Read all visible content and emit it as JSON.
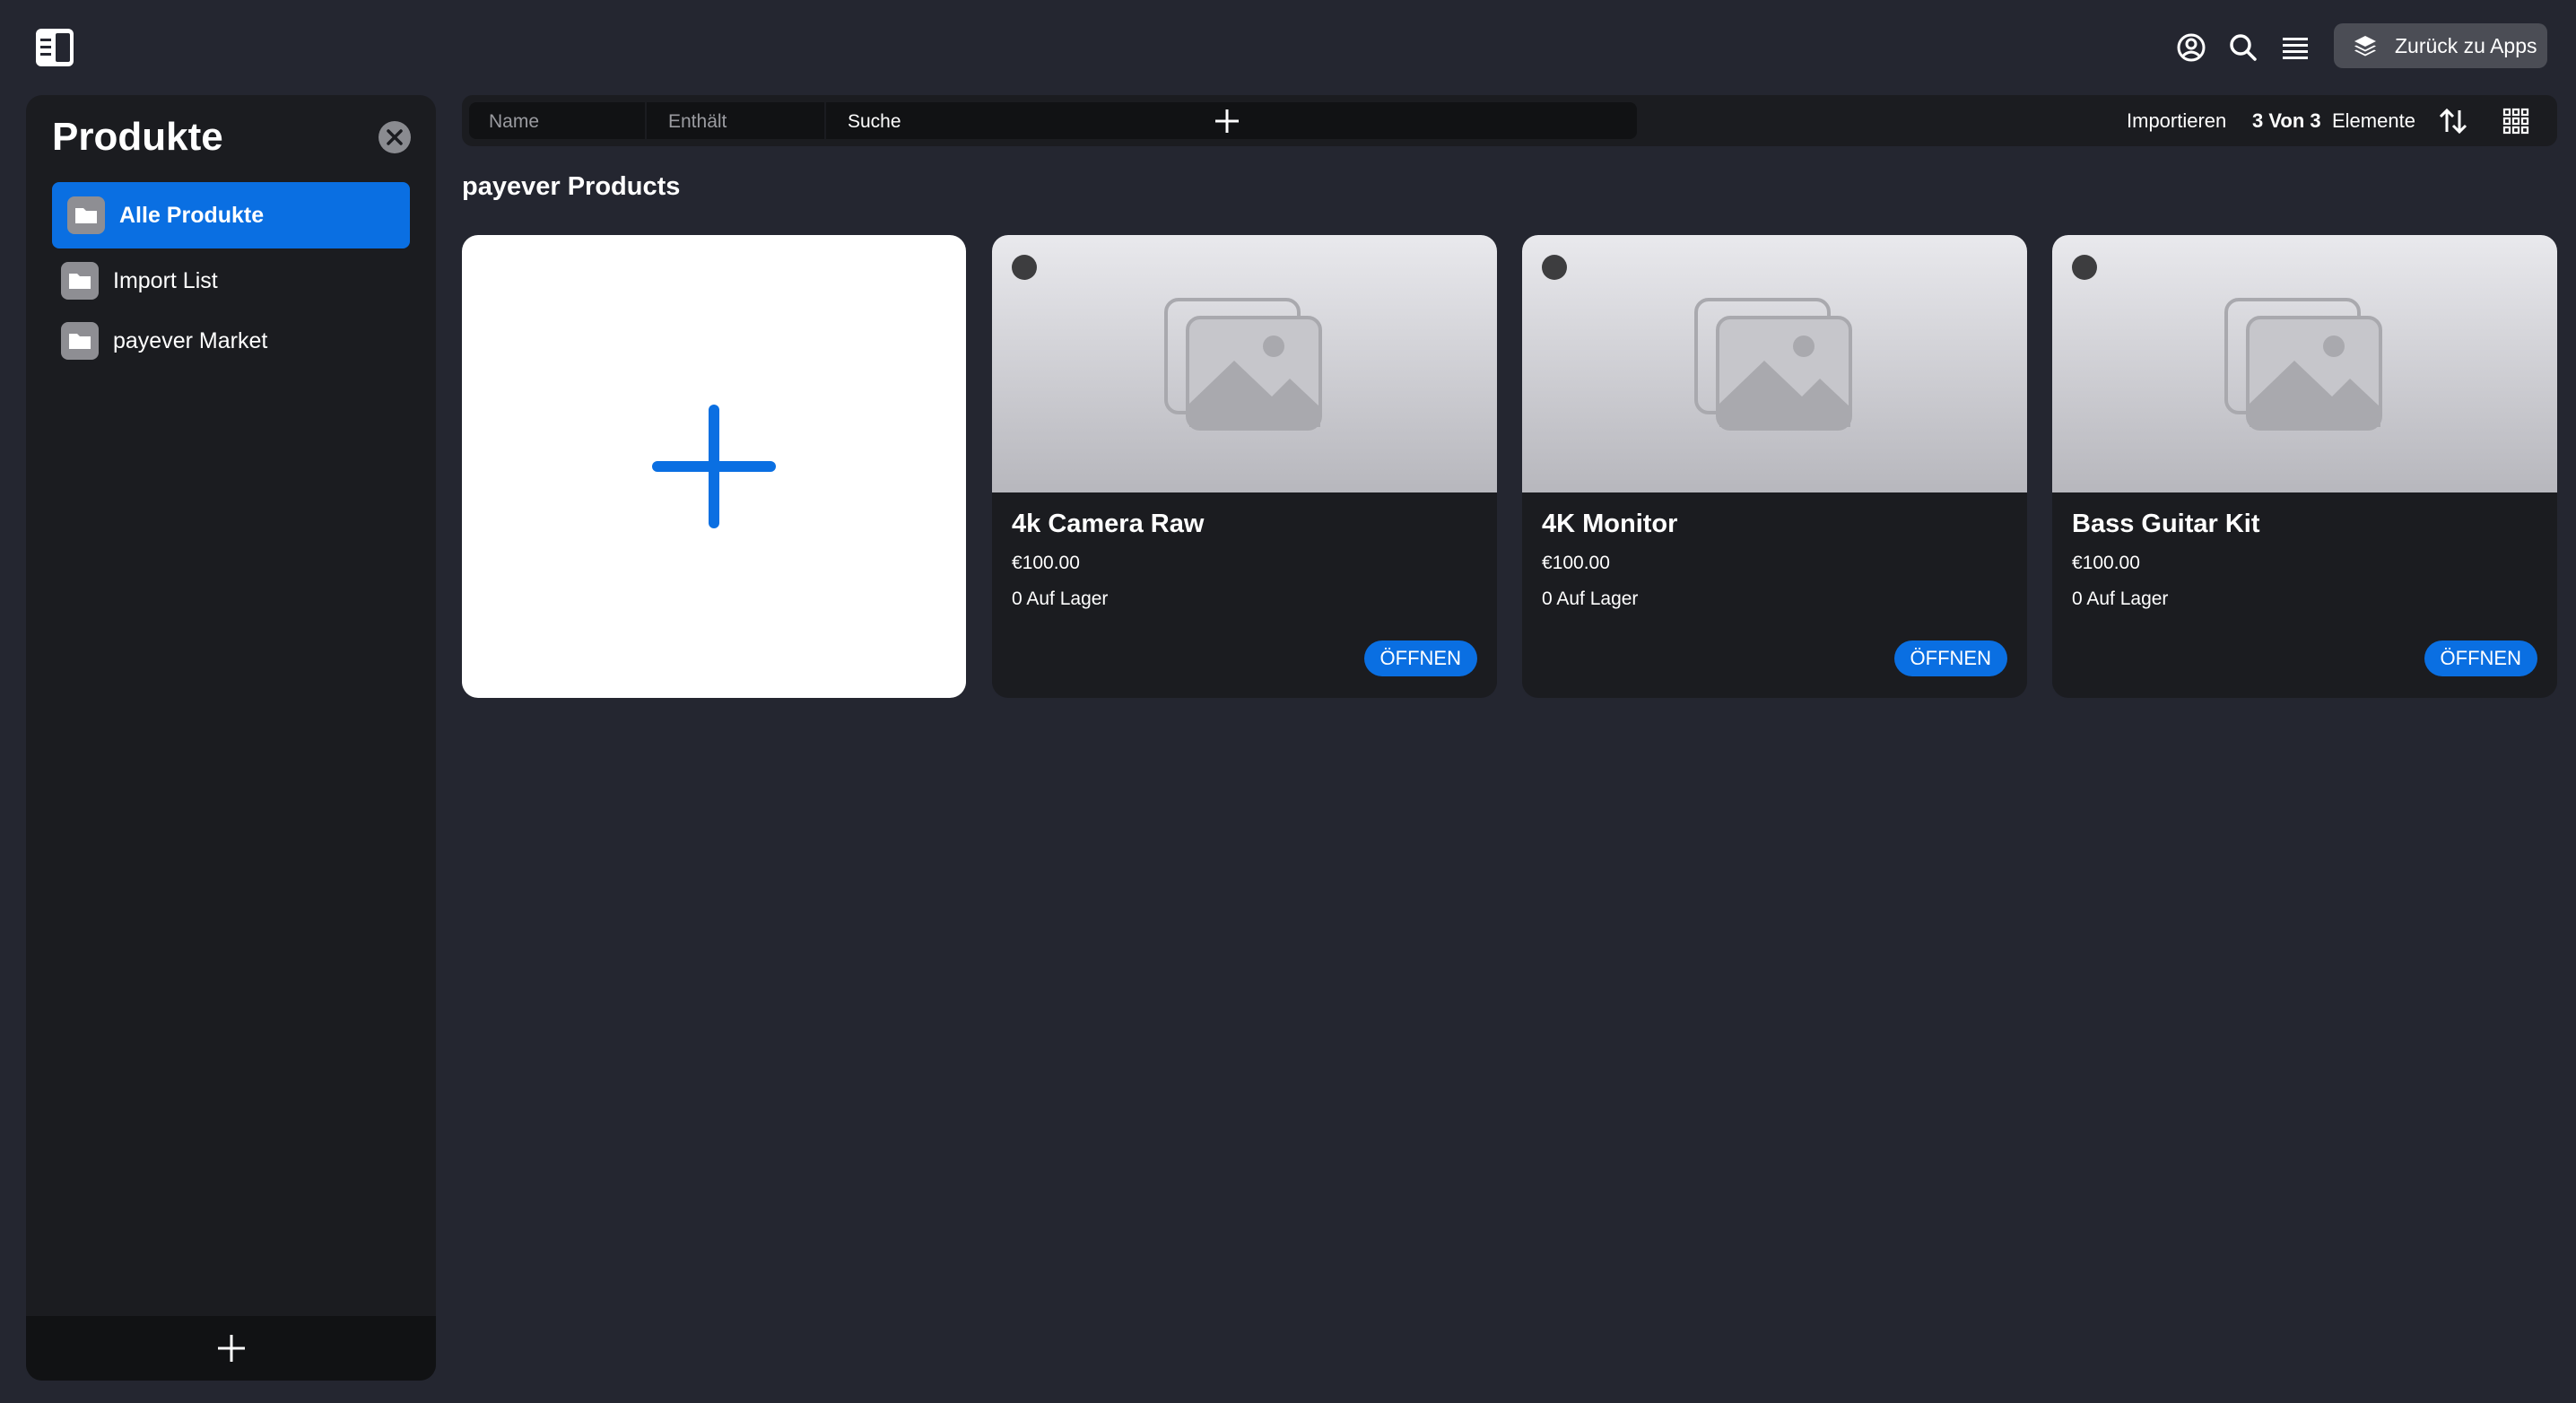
{
  "topbar": {
    "back_label": "Zurück zu Apps"
  },
  "sidebar": {
    "title": "Produkte",
    "items": [
      {
        "label": "Alle Produkte",
        "active": true
      },
      {
        "label": "Import List",
        "active": false
      },
      {
        "label": "payever Market",
        "active": false
      }
    ]
  },
  "toolbar": {
    "filter_field": "Name",
    "filter_operator": "Enthält",
    "search_placeholder": "Suche",
    "import_label": "Importieren",
    "count": "3 Von 3",
    "count_suffix": "Elemente"
  },
  "main": {
    "section_title": "payever Products",
    "products": [
      {
        "name": "4k Camera Raw",
        "price": "€100.00",
        "stock": "0 Auf Lager",
        "open_label": "ÖFFNEN"
      },
      {
        "name": "4K Monitor",
        "price": "€100.00",
        "stock": "0 Auf Lager",
        "open_label": "ÖFFNEN"
      },
      {
        "name": "Bass Guitar Kit",
        "price": "€100.00",
        "stock": "0 Auf Lager",
        "open_label": "ÖFFNEN"
      }
    ]
  },
  "colors": {
    "accent": "#0a6fe2",
    "background": "#242630",
    "panel": "#1b1c20"
  }
}
